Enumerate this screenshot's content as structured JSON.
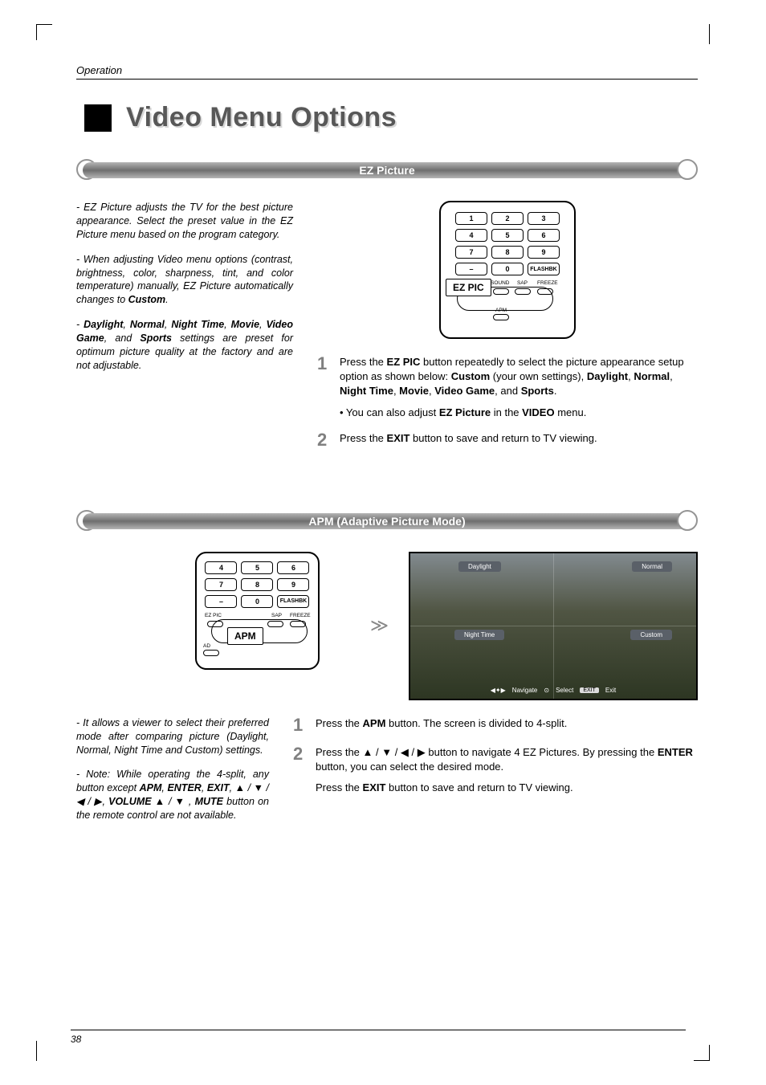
{
  "header": {
    "section": "Operation"
  },
  "title": "Video Menu Options",
  "ez": {
    "heading": "EZ Picture",
    "intro1": "EZ Picture adjusts the TV for the best picture appearance. Select the preset value in the EZ Picture menu based on the program category.",
    "intro2_a": "When adjusting Video menu options (contrast, brightness, color, sharpness, tint, and color temperature) manually, EZ Picture automatically changes to ",
    "intro2_b": "Custom",
    "intro2_c": ".",
    "intro3_modes": [
      "Daylight",
      "Normal",
      "Night Time",
      "Movie",
      "Video Game",
      "Sports"
    ],
    "intro3_mid": ", and ",
    "intro3_tail": " settings are preset for optimum picture quality at the factory and are not adjustable.",
    "remote_label": "EZ PIC",
    "keys": {
      "r1": [
        "1",
        "2",
        "3"
      ],
      "r2": [
        "4",
        "5",
        "6"
      ],
      "r3": [
        "7",
        "8",
        "9"
      ],
      "r4": [
        "–",
        "0",
        "FLASHBK"
      ],
      "labels": {
        "sound": "SOUND",
        "sap": "SAP",
        "freeze": "FREEZE",
        "apm": "APM"
      }
    },
    "step1_a": "Press the ",
    "step1_b": "EZ PIC",
    "step1_c": " button repeatedly to select the picture appearance setup option as shown below: ",
    "step1_d": "Custom",
    "step1_e": " (your own settings), ",
    "step1_list": [
      "Daylight",
      "Normal",
      "Night Time",
      "Movie",
      "Video Game"
    ],
    "step1_and": ", and ",
    "step1_last": "Sports",
    "step1_period": ".",
    "step1_sub_a": "• You can also adjust ",
    "step1_sub_b": "EZ Picture",
    "step1_sub_c": " in the ",
    "step1_sub_d": "VIDEO",
    "step1_sub_e": " menu.",
    "step2_a": "Press the ",
    "step2_b": "EXIT",
    "step2_c": " button to save and return to TV viewing."
  },
  "apm": {
    "heading": "APM (Adaptive Picture Mode)",
    "remote_label": "APM",
    "keys": {
      "r1": [
        "4",
        "5",
        "6"
      ],
      "r2": [
        "7",
        "8",
        "9"
      ],
      "r3": [
        "–",
        "0",
        "FLASHBK"
      ],
      "labels": {
        "ezpic": "EZ PIC",
        "sap": "SAP",
        "freeze": "FREEZE",
        "apm": "APM"
      }
    },
    "screen_labels": {
      "tl": "Daylight",
      "tr": "Normal",
      "bl": "Night Time",
      "br": "Custom"
    },
    "screen_footer": {
      "nav": "Navigate",
      "sel": "Select",
      "exitbtn": "EXIT",
      "exit": "Exit"
    },
    "left1": "It allows a viewer to select their preferred mode after comparing picture (Daylight, Normal, Night Time and Custom) settings.",
    "left2_a": "Note: While operating the 4-split, any button except ",
    "left2_b": "APM",
    "left2_c": ", ",
    "left2_d": "ENTER",
    "left2_e": ", ",
    "left2_f": "EXIT",
    "left2_g": ", ▲ / ▼ / ◀ / ▶, ",
    "left2_h": "VOLUME",
    "left2_i": " ▲ / ▼ , ",
    "left2_j": "MUTE",
    "left2_k": " button on the remote control are not available.",
    "step1_a": "Press the ",
    "step1_b": "APM",
    "step1_c": " button. The screen is divided to 4-split.",
    "step2_a": "Press the ▲ / ▼ / ◀ / ▶ button to navigate 4 EZ Pictures. By pressing the ",
    "step2_b": "ENTER",
    "step2_c": " button, you can select the desired mode.",
    "step3_a": "Press the ",
    "step3_b": "EXIT",
    "step3_c": " button to save and return to TV viewing."
  },
  "page_number": "38"
}
